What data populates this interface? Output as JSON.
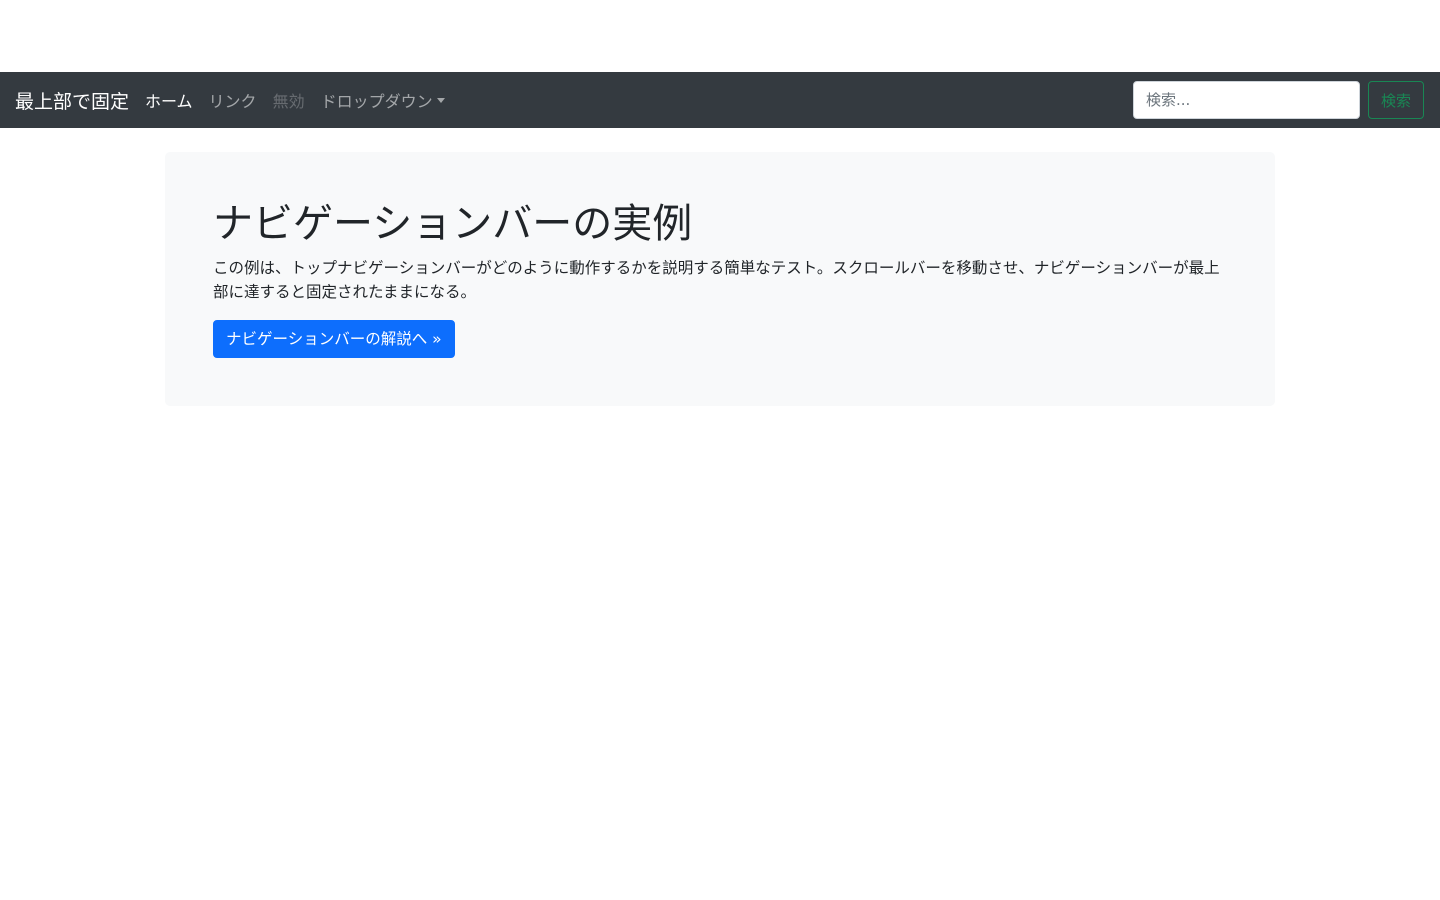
{
  "navbar": {
    "brand": "最上部で固定",
    "links": [
      {
        "label": "ホーム",
        "state": "active"
      },
      {
        "label": "リンク",
        "state": "normal"
      },
      {
        "label": "無効",
        "state": "disabled"
      },
      {
        "label": "ドロップダウン",
        "state": "dropdown"
      }
    ],
    "search": {
      "placeholder": "検索...",
      "value": "",
      "button_label": "検索"
    }
  },
  "jumbotron": {
    "title": "ナビゲーションバーの実例",
    "lead": "この例は、トップナビゲーションバーがどのように動作するかを説明する簡単なテスト。スクロールバーを移動させ、ナビゲーションバーが最上部に達すると固定されたままになる。",
    "button_label": "ナビゲーションバーの解説へ »"
  },
  "colors": {
    "navbar_bg": "#343a40",
    "primary": "#0d6efd",
    "success": "#198754",
    "jumbotron_bg": "#f8f9fa"
  }
}
